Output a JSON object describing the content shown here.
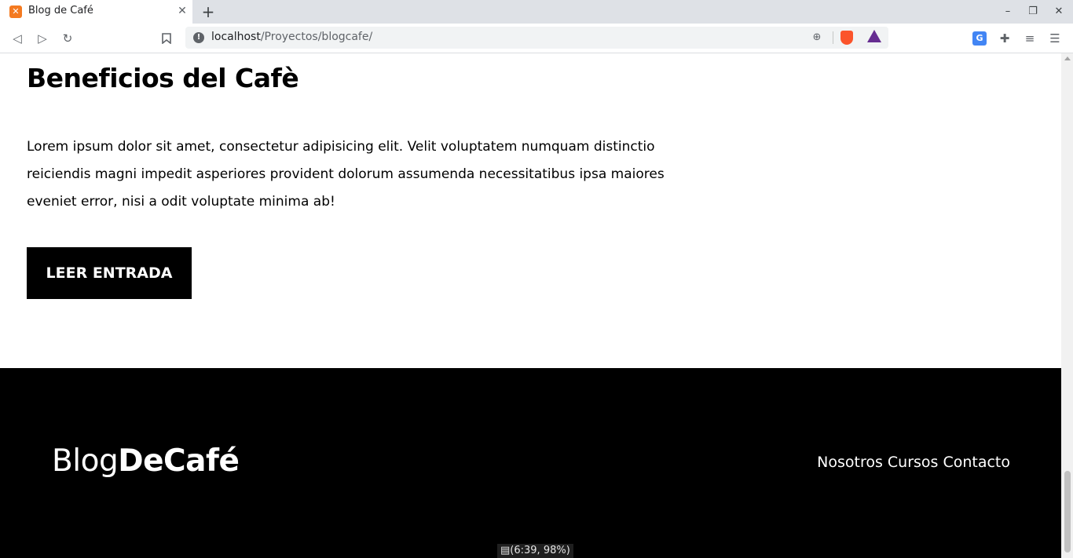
{
  "browser": {
    "tab": {
      "title": "Blog de Café",
      "favicon": "xampp-icon",
      "close_glyph": "✕"
    },
    "new_tab_glyph": "+",
    "window_controls": {
      "minimize": "–",
      "restore": "❐",
      "close": "✕"
    },
    "nav": {
      "back": "◁",
      "forward": "▷",
      "reload": "↻",
      "bookmark": "🔖"
    },
    "url": {
      "host": "localhost",
      "path": "/Proyectos/blogcafe/",
      "info_glyph": "!",
      "zoom_glyph": "⊕"
    },
    "extensions": {
      "translate_glyph": "G",
      "puzzle_glyph": "✚",
      "queue_glyph": "≡",
      "menu_glyph": "☰"
    }
  },
  "entry": {
    "title": "Beneficios del Cafè",
    "body": "Lorem ipsum dolor sit amet, consectetur adipisicing elit. Velit voluptatem numquam distinctio reiciendis magni impedit asperiores provident dolorum assumenda necessitatibus ipsa maiores eveniet error, nisi a odit voluptate minima ab!",
    "button_label": "LEER ENTRADA"
  },
  "footer": {
    "logo_light": "Blog",
    "logo_bold": "DeCafé",
    "nav": [
      "Nosotros",
      "Cursos",
      "Contacto"
    ]
  },
  "status_overlay": "(6:39, 98%)",
  "colors": {
    "footer_bg": "#000000",
    "button_bg": "#000000",
    "brave": "#fb542b",
    "rewards": "#662d91"
  }
}
